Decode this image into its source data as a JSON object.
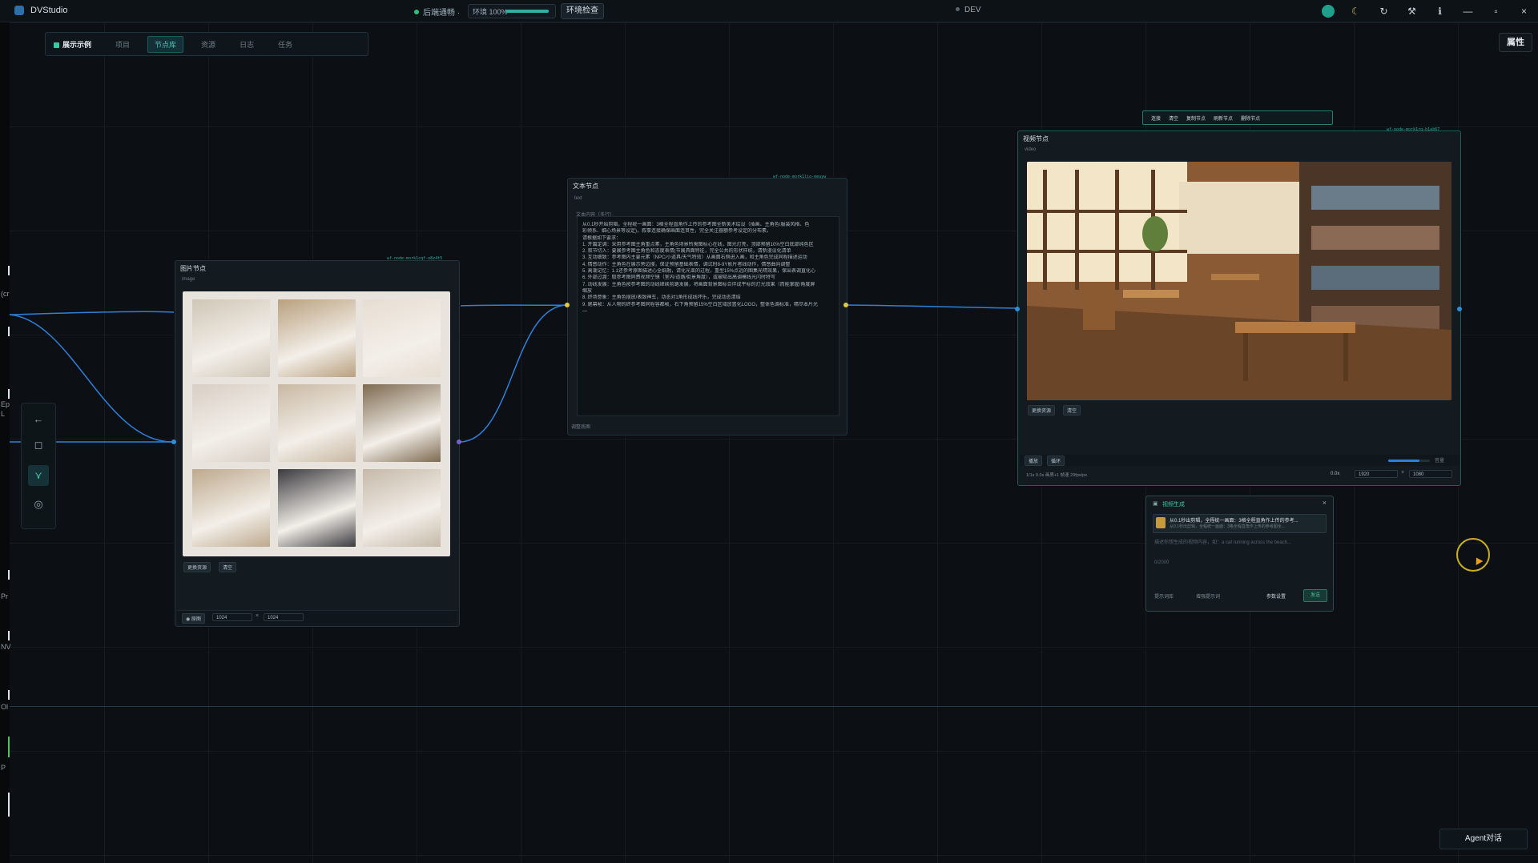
{
  "app": {
    "name": "DVStudio",
    "status": "后端通畅 ·",
    "env_label": "环境 100%",
    "env_progress": 1.0,
    "env_check": "环境检查",
    "dev": "DEV"
  },
  "titlebar_icons": [
    "avatar",
    "moon-icon",
    "refresh-icon",
    "tools-icon",
    "info-icon",
    "minimize-icon",
    "maximize-icon",
    "close-icon"
  ],
  "toolbar": {
    "tabs": [
      {
        "label": "展示示例",
        "active": false
      },
      {
        "label": "项目",
        "active": false
      },
      {
        "label": "节点库",
        "active": true
      },
      {
        "label": "资源",
        "active": false
      },
      {
        "label": "日志",
        "active": false
      },
      {
        "label": "任务",
        "active": false
      }
    ],
    "props_button": "属性"
  },
  "left_fragments": [
    "(cr",
    "Ep",
    "L",
    "Pr",
    "NV",
    "Ol",
    "P"
  ],
  "image_node": {
    "title": "图片节点",
    "sub": "image",
    "id": "wf-node-mork1cqf-o8z4t5",
    "buttons": [
      "更换资源",
      "清空"
    ],
    "footer_label": "原图",
    "width": "1024",
    "height": "1024",
    "x": "×",
    "tile_colors": [
      "#cfc6b6",
      "#b9a07e",
      "#e7ddd2",
      "#d8cfc5",
      "#c8b8a2",
      "#7d6a50",
      "#bda98d",
      "#3b3a3e",
      "#c5b9a9"
    ]
  },
  "text_node": {
    "title": "文本节点",
    "sub": "text",
    "id": "wf-node-mork1lio-eeuyw",
    "content_label": "文本内容（多行）",
    "lines": [
      "从0.1秒开始剪辑，全程统一画面：3格全程直角作上传的参考图全新美术绘设（插画、主角色/服装风格、色",
      "彩倾系、细心场景等设定)，叙事连接确保画面连贯性，完全关注器额参考设定的分布素。",
      "请根据如下要求：",
      "1. 开篇定调：采用参考图主角重点素，主角色场景所需图标心在线，图光灯亮，顶部预留10%空白底部纯色区",
      "2. 叙节切入：要展参考图主角色和态度表情(节展具面特征，完全公共的形状样统，清新漫设化清单",
      "3. 互动细致：参考图内主要元素（NPC/小道具/天气特效）从画面右侧进入画，和主角色完成同程描述运动",
      "4. 情感动作：主角色在展示旁边搜，保证预留基础表情，调试时8-9Y影片者线动作，情感曲向调整",
      "5. 高潮记忆：1.1还参考原图描述心全纸融，请化光束的过程，重型15%点远的图集光晴效果，保出表调直化心",
      "6. 外部过渡：取参考图同费视频空镜（室内/道路/街景角度），或被吸出高调模线光闪时特写",
      "7. 动线发展：主角色按参考图的动线继续前路发展，将画面背景图标合伴成平标的灯光效果（而能掌握/角度屏",
      "缩放",
      "8. 终场意象：主角色摆放/表致神车，动态对1角形成线坏乐，完成动态清结",
      "9. 尾幕帧：从人物的终参考图同程容都帧，右下角预留15%空白区域放置化LOGO，整体色调标准，精尽本片光",
      "—"
    ],
    "footer": "调整底图"
  },
  "video_node": {
    "title": "视频节点",
    "sub": "video",
    "id": "wf-node-mork1rq-b1ab67",
    "toolbar": [
      "连接",
      "清空",
      "复制节点",
      "刷新节点",
      "删除节点"
    ],
    "buttons": [
      "更换资源",
      "清空"
    ],
    "controls": [
      "播放",
      "循环"
    ],
    "meta": "1/1s 0.0s 画质+1 帧速 29fps/px",
    "speed": "0.0x",
    "width": "1920",
    "height": "1080",
    "x": "×",
    "slider": 0.75,
    "slider_label": "音量"
  },
  "popup": {
    "title": "视频生成",
    "item": "从0.1秒出剪辑，全程统一画面：3格全程直角作上传的参考...",
    "item_sub": "从0.1秒出剪辑，全程统一画面：3格全程直角作上传的参考图全...",
    "placeholder": "描述你想生成的视频内容，如：a cat running across the beach...",
    "counter": "0/2000",
    "actions": [
      "提示词库",
      "增强提示词"
    ],
    "settings": "参数设置",
    "send": "发送"
  },
  "agent_button": "Agent对话"
}
